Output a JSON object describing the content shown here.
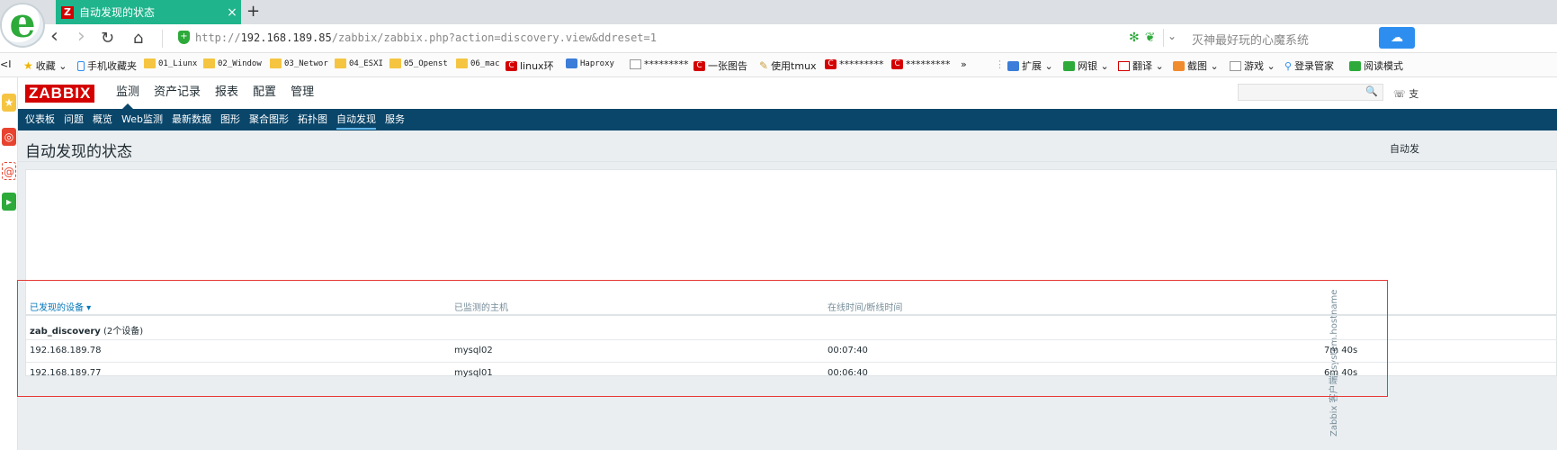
{
  "browser": {
    "tab": {
      "favicon": "Z",
      "title": "自动发现的状态",
      "close": "×"
    },
    "new_tab": "+",
    "nav": {
      "back": "‹",
      "forward": "›",
      "reload": "↻",
      "home": "⌂"
    },
    "url": {
      "scheme": "http://",
      "host": "192.168.189.85",
      "path": "/zabbix/zabbix.php?action=discovery.view&ddreset=1"
    },
    "search_hint": "灭神最好玩的心魔系统",
    "bookmarks": [
      {
        "label": "收藏",
        "icon": "star-icon"
      },
      {
        "label": "手机收藏夹",
        "icon": "phone-icon"
      },
      {
        "label": "01_Liunx",
        "icon": "folder-icon"
      },
      {
        "label": "02_Window",
        "icon": "folder-icon"
      },
      {
        "label": "03_Networ",
        "icon": "folder-icon"
      },
      {
        "label": "04_ESXI",
        "icon": "folder-icon"
      },
      {
        "label": "05_Openst",
        "icon": "folder-icon"
      },
      {
        "label": "06_mac",
        "icon": "folder-icon"
      },
      {
        "label": "linux环",
        "icon": "csdn-icon"
      },
      {
        "label": "Haproxy",
        "icon": "bookmark-icon"
      },
      {
        "label": "*********",
        "icon": "page-icon"
      },
      {
        "label": "一张图告",
        "icon": "csdn-icon"
      },
      {
        "label": "使用tmux",
        "icon": "pen-icon"
      },
      {
        "label": "*********",
        "icon": "csdn-icon"
      },
      {
        "label": "*********",
        "icon": "csdn-icon"
      },
      {
        "label": "»",
        "icon": ""
      }
    ],
    "toolbar_right": [
      {
        "label": "扩展",
        "icon": "grid-icon"
      },
      {
        "label": "网银",
        "icon": "bank-icon"
      },
      {
        "label": "翻译",
        "icon": "translate-icon"
      },
      {
        "label": "截图",
        "icon": "scissors-icon"
      },
      {
        "label": "游戏",
        "icon": "gamepad-icon"
      },
      {
        "label": "登录管家",
        "icon": "search-icon"
      },
      {
        "label": "阅读模式",
        "icon": "book-icon"
      }
    ]
  },
  "zabbix": {
    "logo": "ZABBIX",
    "main_menu": [
      "监测",
      "资产记录",
      "报表",
      "配置",
      "管理"
    ],
    "sub_menu": [
      "仪表板",
      "问题",
      "概览",
      "Web监测",
      "最新数据",
      "图形",
      "聚合图形",
      "拓扑图",
      "自动发现",
      "服务"
    ],
    "support": "支",
    "page_title": "自动发现的状态",
    "header_right": "自动发",
    "table": {
      "headers": {
        "device": "已发现的设备 ▾",
        "host": "已监测的主机",
        "time": "在线时间/断线时间",
        "vertical": "Zabbix 客户端: system.hostname"
      },
      "group": {
        "name": "zab_discovery",
        "count": "(2个设备)"
      },
      "rows": [
        {
          "ip": "192.168.189.78",
          "host": "mysql02",
          "uptime": "00:07:40",
          "check": "7m 40s"
        },
        {
          "ip": "192.168.189.77",
          "host": "mysql01",
          "uptime": "00:06:40",
          "check": "6m 40s"
        }
      ]
    }
  }
}
